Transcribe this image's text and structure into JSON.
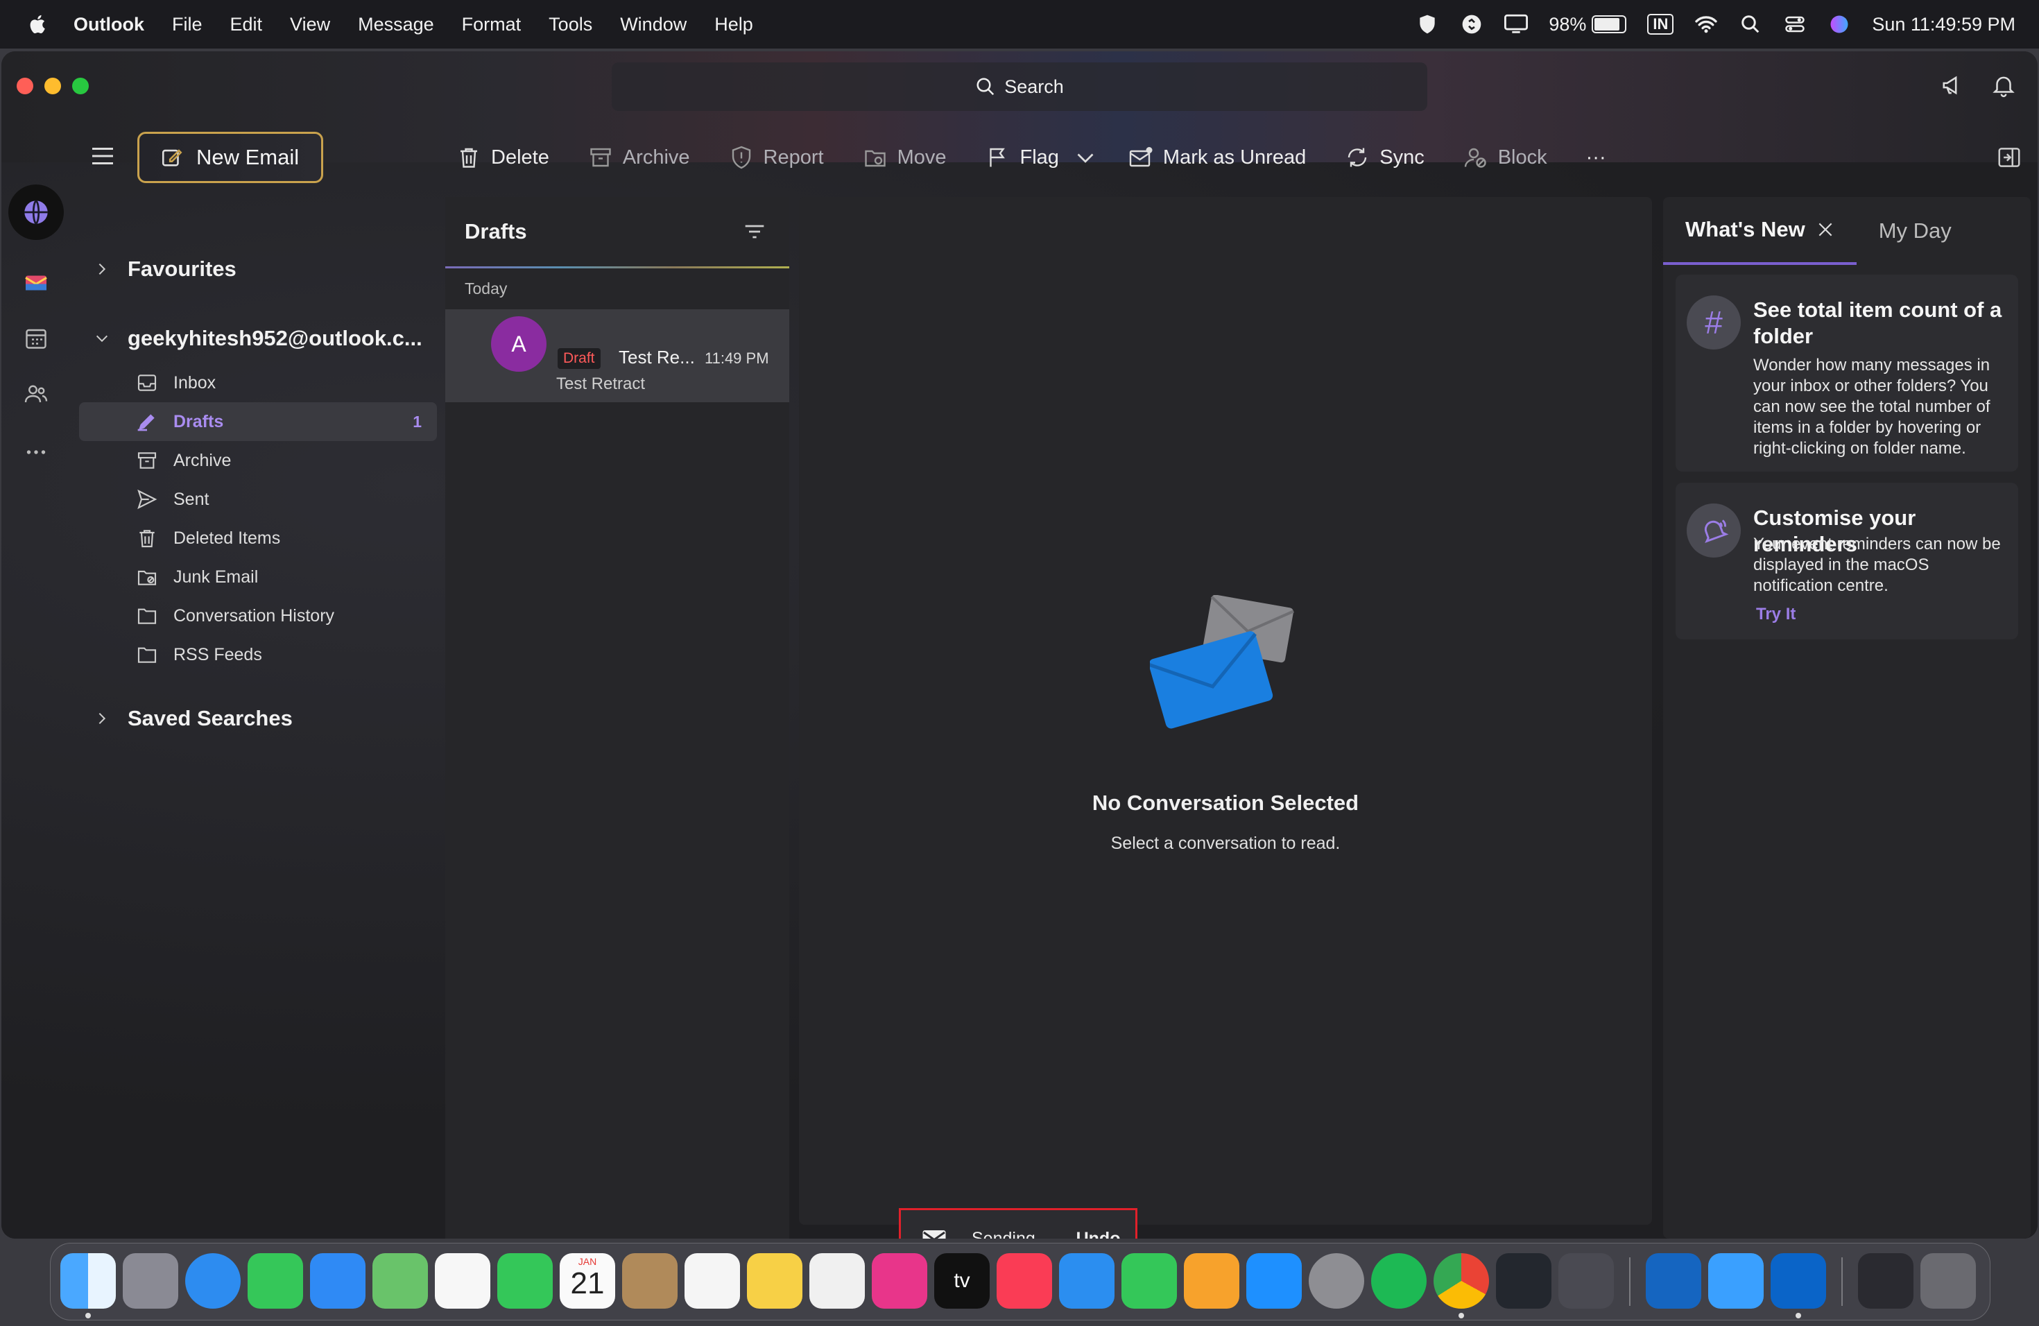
{
  "menubar": {
    "app_name": "Outlook",
    "items": [
      "File",
      "Edit",
      "View",
      "Message",
      "Format",
      "Tools",
      "Window",
      "Help"
    ],
    "battery": "98%",
    "input_source": "IN",
    "clock": "Sun 11:49:59 PM"
  },
  "search": {
    "placeholder": "Search"
  },
  "new_email_label": "New Email",
  "toolbar": {
    "delete": "Delete",
    "archive": "Archive",
    "report": "Report",
    "move": "Move",
    "flag": "Flag",
    "mark_unread": "Mark as Unread",
    "sync": "Sync",
    "block": "Block",
    "more": "···"
  },
  "sidebar": {
    "favourites": "Favourites",
    "account": "geekyhitesh952@outlook.c...",
    "saved_searches": "Saved Searches",
    "folders": [
      {
        "label": "Inbox",
        "icon": "inbox-icon",
        "count": ""
      },
      {
        "label": "Drafts",
        "icon": "drafts-icon",
        "count": "1"
      },
      {
        "label": "Archive",
        "icon": "archive-icon",
        "count": ""
      },
      {
        "label": "Sent",
        "icon": "sent-icon",
        "count": ""
      },
      {
        "label": "Deleted Items",
        "icon": "trash-icon",
        "count": ""
      },
      {
        "label": "Junk Email",
        "icon": "junk-icon",
        "count": ""
      },
      {
        "label": "Conversation History",
        "icon": "folder-icon",
        "count": ""
      },
      {
        "label": "RSS Feeds",
        "icon": "folder-icon",
        "count": ""
      }
    ]
  },
  "message_list": {
    "title": "Drafts",
    "group": "Today",
    "messages": [
      {
        "avatar_letter": "A",
        "badge": "Draft",
        "subject": "Test Re...",
        "time": "11:49 PM",
        "preview": "Test Retract"
      }
    ]
  },
  "reading_pane": {
    "empty_title": "No Conversation Selected",
    "empty_subtitle": "Select a conversation to read."
  },
  "toast": {
    "status": "Sending...",
    "undo": "Undo"
  },
  "right_pane": {
    "tabs": [
      "What's New",
      "My Day"
    ],
    "cards": [
      {
        "title": "See total item count of a folder",
        "body": "Wonder how many messages in your inbox or other folders? You can now see the total number of items in a folder by hovering or right-clicking on folder name.",
        "link": ""
      },
      {
        "title": "Customise your reminders",
        "body": "Your event reminders can now be displayed in the macOS notification centre.",
        "link": "Try It"
      }
    ]
  },
  "dock": {
    "calendar_month": "JAN",
    "calendar_day": "21",
    "tv_label": "tv"
  },
  "colors": {
    "accent": "#a98cf0",
    "draft_red": "#ff5a5a",
    "avatar": "#8a2ca0",
    "toast_border": "#e0202a"
  }
}
